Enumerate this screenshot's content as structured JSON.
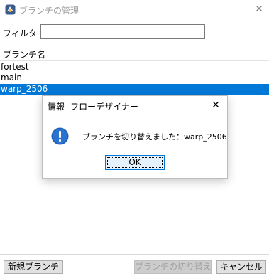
{
  "window": {
    "title": "ブランチの管理",
    "app_icon": "app-logo-icon",
    "close_icon": "close-icon",
    "close_glyph": "✕"
  },
  "filter": {
    "label": "フィルター:",
    "value": "",
    "placeholder": ""
  },
  "branch_list": {
    "header": "ブランチ名",
    "items": [
      {
        "label": "fortest",
        "selected": false
      },
      {
        "label": "main",
        "selected": false
      },
      {
        "label": "warp_2506",
        "selected": true
      }
    ]
  },
  "buttons": {
    "new_branch": "新規ブランチ",
    "switch_branch": "ブランチの切り替え",
    "cancel": "キャンセル"
  },
  "dialog": {
    "title": "情報 -フローデザイナー",
    "close_glyph": "✕",
    "icon": "info-icon",
    "message": "ブランチを切り替えました：warp_2506",
    "ok_label": "OK"
  },
  "colors": {
    "selection": "#0078d7",
    "info_icon": "#1a5fb4",
    "disabled_text": "#a0a0a0"
  }
}
